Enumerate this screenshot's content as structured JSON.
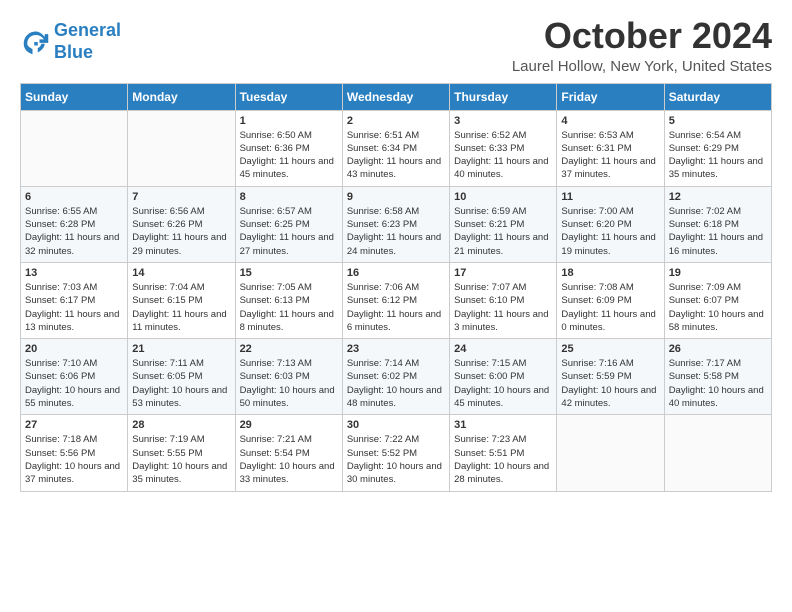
{
  "header": {
    "logo_line1": "General",
    "logo_line2": "Blue",
    "month": "October 2024",
    "location": "Laurel Hollow, New York, United States"
  },
  "weekdays": [
    "Sunday",
    "Monday",
    "Tuesday",
    "Wednesday",
    "Thursday",
    "Friday",
    "Saturday"
  ],
  "weeks": [
    [
      {
        "day": "",
        "detail": ""
      },
      {
        "day": "",
        "detail": ""
      },
      {
        "day": "1",
        "detail": "Sunrise: 6:50 AM\nSunset: 6:36 PM\nDaylight: 11 hours and 45 minutes."
      },
      {
        "day": "2",
        "detail": "Sunrise: 6:51 AM\nSunset: 6:34 PM\nDaylight: 11 hours and 43 minutes."
      },
      {
        "day": "3",
        "detail": "Sunrise: 6:52 AM\nSunset: 6:33 PM\nDaylight: 11 hours and 40 minutes."
      },
      {
        "day": "4",
        "detail": "Sunrise: 6:53 AM\nSunset: 6:31 PM\nDaylight: 11 hours and 37 minutes."
      },
      {
        "day": "5",
        "detail": "Sunrise: 6:54 AM\nSunset: 6:29 PM\nDaylight: 11 hours and 35 minutes."
      }
    ],
    [
      {
        "day": "6",
        "detail": "Sunrise: 6:55 AM\nSunset: 6:28 PM\nDaylight: 11 hours and 32 minutes."
      },
      {
        "day": "7",
        "detail": "Sunrise: 6:56 AM\nSunset: 6:26 PM\nDaylight: 11 hours and 29 minutes."
      },
      {
        "day": "8",
        "detail": "Sunrise: 6:57 AM\nSunset: 6:25 PM\nDaylight: 11 hours and 27 minutes."
      },
      {
        "day": "9",
        "detail": "Sunrise: 6:58 AM\nSunset: 6:23 PM\nDaylight: 11 hours and 24 minutes."
      },
      {
        "day": "10",
        "detail": "Sunrise: 6:59 AM\nSunset: 6:21 PM\nDaylight: 11 hours and 21 minutes."
      },
      {
        "day": "11",
        "detail": "Sunrise: 7:00 AM\nSunset: 6:20 PM\nDaylight: 11 hours and 19 minutes."
      },
      {
        "day": "12",
        "detail": "Sunrise: 7:02 AM\nSunset: 6:18 PM\nDaylight: 11 hours and 16 minutes."
      }
    ],
    [
      {
        "day": "13",
        "detail": "Sunrise: 7:03 AM\nSunset: 6:17 PM\nDaylight: 11 hours and 13 minutes."
      },
      {
        "day": "14",
        "detail": "Sunrise: 7:04 AM\nSunset: 6:15 PM\nDaylight: 11 hours and 11 minutes."
      },
      {
        "day": "15",
        "detail": "Sunrise: 7:05 AM\nSunset: 6:13 PM\nDaylight: 11 hours and 8 minutes."
      },
      {
        "day": "16",
        "detail": "Sunrise: 7:06 AM\nSunset: 6:12 PM\nDaylight: 11 hours and 6 minutes."
      },
      {
        "day": "17",
        "detail": "Sunrise: 7:07 AM\nSunset: 6:10 PM\nDaylight: 11 hours and 3 minutes."
      },
      {
        "day": "18",
        "detail": "Sunrise: 7:08 AM\nSunset: 6:09 PM\nDaylight: 11 hours and 0 minutes."
      },
      {
        "day": "19",
        "detail": "Sunrise: 7:09 AM\nSunset: 6:07 PM\nDaylight: 10 hours and 58 minutes."
      }
    ],
    [
      {
        "day": "20",
        "detail": "Sunrise: 7:10 AM\nSunset: 6:06 PM\nDaylight: 10 hours and 55 minutes."
      },
      {
        "day": "21",
        "detail": "Sunrise: 7:11 AM\nSunset: 6:05 PM\nDaylight: 10 hours and 53 minutes."
      },
      {
        "day": "22",
        "detail": "Sunrise: 7:13 AM\nSunset: 6:03 PM\nDaylight: 10 hours and 50 minutes."
      },
      {
        "day": "23",
        "detail": "Sunrise: 7:14 AM\nSunset: 6:02 PM\nDaylight: 10 hours and 48 minutes."
      },
      {
        "day": "24",
        "detail": "Sunrise: 7:15 AM\nSunset: 6:00 PM\nDaylight: 10 hours and 45 minutes."
      },
      {
        "day": "25",
        "detail": "Sunrise: 7:16 AM\nSunset: 5:59 PM\nDaylight: 10 hours and 42 minutes."
      },
      {
        "day": "26",
        "detail": "Sunrise: 7:17 AM\nSunset: 5:58 PM\nDaylight: 10 hours and 40 minutes."
      }
    ],
    [
      {
        "day": "27",
        "detail": "Sunrise: 7:18 AM\nSunset: 5:56 PM\nDaylight: 10 hours and 37 minutes."
      },
      {
        "day": "28",
        "detail": "Sunrise: 7:19 AM\nSunset: 5:55 PM\nDaylight: 10 hours and 35 minutes."
      },
      {
        "day": "29",
        "detail": "Sunrise: 7:21 AM\nSunset: 5:54 PM\nDaylight: 10 hours and 33 minutes."
      },
      {
        "day": "30",
        "detail": "Sunrise: 7:22 AM\nSunset: 5:52 PM\nDaylight: 10 hours and 30 minutes."
      },
      {
        "day": "31",
        "detail": "Sunrise: 7:23 AM\nSunset: 5:51 PM\nDaylight: 10 hours and 28 minutes."
      },
      {
        "day": "",
        "detail": ""
      },
      {
        "day": "",
        "detail": ""
      }
    ]
  ]
}
